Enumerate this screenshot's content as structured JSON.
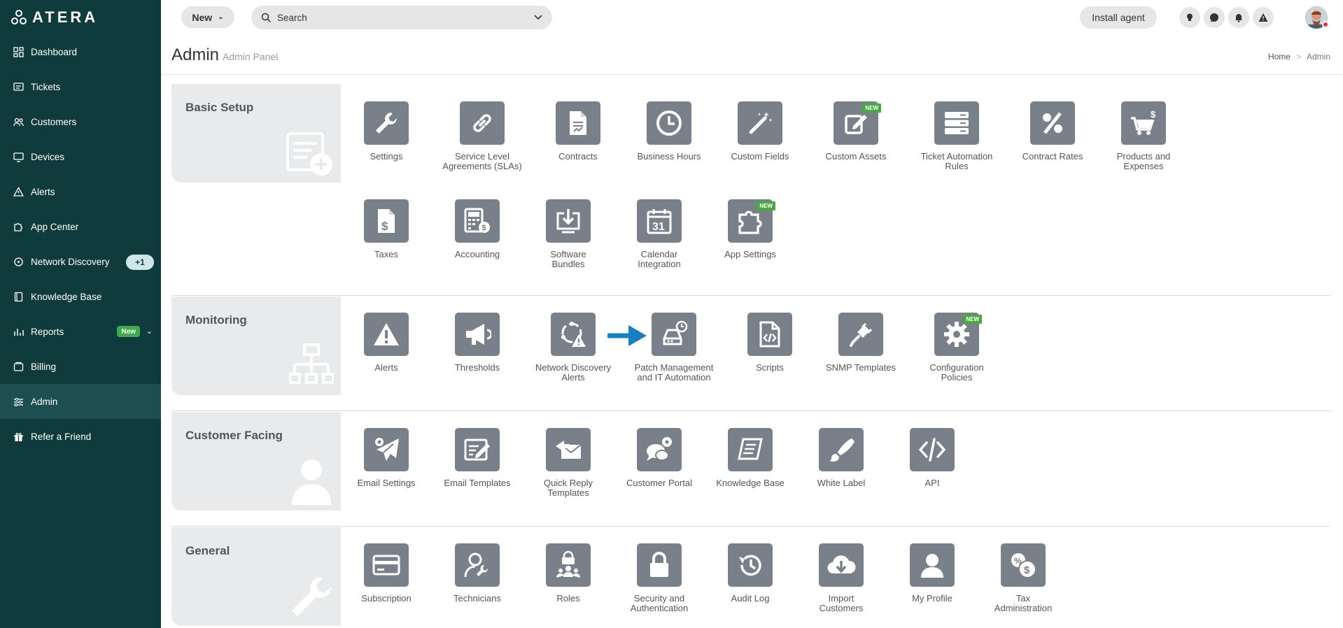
{
  "app": {
    "logo_text": "ATERA"
  },
  "sidebar": {
    "items": [
      {
        "label": "Dashboard",
        "icon": "dashboard-icon"
      },
      {
        "label": "Tickets",
        "icon": "tickets-icon"
      },
      {
        "label": "Customers",
        "icon": "customers-icon"
      },
      {
        "label": "Devices",
        "icon": "devices-icon"
      },
      {
        "label": "Alerts",
        "icon": "alert-triangle-icon"
      },
      {
        "label": "App Center",
        "icon": "puzzle-icon"
      },
      {
        "label": "Network Discovery",
        "icon": "network-icon",
        "badge": "+1"
      },
      {
        "label": "Knowledge Base",
        "icon": "book-icon"
      },
      {
        "label": "Reports",
        "icon": "reports-icon",
        "tag": "New"
      },
      {
        "label": "Billing",
        "icon": "billing-icon"
      },
      {
        "label": "Admin",
        "icon": "admin-sliders-icon",
        "active": true
      },
      {
        "label": "Refer a Friend",
        "icon": "gift-icon"
      }
    ]
  },
  "topbar": {
    "new_label": "New",
    "search_placeholder": "Search",
    "install_label": "Install agent"
  },
  "header": {
    "title": "Admin",
    "subtitle": "Admin Panel",
    "breadcrumb": [
      "Home",
      "Admin"
    ],
    "breadcrumb_sep": ">"
  },
  "sections": {
    "basic": {
      "title": "Basic Setup",
      "tiles": [
        {
          "label": "Settings",
          "icon": "wrench-icon"
        },
        {
          "label": "Service Level\nAgreements (SLAs)",
          "icon": "link-icon"
        },
        {
          "label": "Contracts",
          "icon": "contract-icon"
        },
        {
          "label": "Business Hours",
          "icon": "clock-icon"
        },
        {
          "label": "Custom Fields",
          "icon": "magic-wand-icon"
        },
        {
          "label": "Custom Assets",
          "icon": "edit-note-icon",
          "tag": "NEW"
        },
        {
          "label": "Ticket Automation\nRules",
          "icon": "server-stack-icon"
        },
        {
          "label": "Contract Rates",
          "icon": "percent-icon"
        },
        {
          "label": "Products and\nExpenses",
          "icon": "cart-dollar-icon"
        },
        {
          "label": "Taxes",
          "icon": "tax-doc-icon"
        },
        {
          "label": "Accounting",
          "icon": "calculator-icon"
        },
        {
          "label": "Software\nBundles",
          "icon": "download-box-icon"
        },
        {
          "label": "Calendar\nIntegration",
          "icon": "calendar-icon",
          "day": "31"
        },
        {
          "label": "App Settings",
          "icon": "puzzle-icon",
          "tag": "NEW"
        }
      ]
    },
    "monitoring": {
      "title": "Monitoring",
      "tiles": [
        {
          "label": "Alerts",
          "icon": "warning-icon"
        },
        {
          "label": "Thresholds",
          "icon": "megaphone-icon"
        },
        {
          "label": "Network Discovery\nAlerts",
          "icon": "network-alert-icon"
        },
        {
          "label": "Patch Management\nand IT Automation",
          "icon": "drive-clock-icon"
        },
        {
          "label": "Scripts",
          "icon": "code-file-icon"
        },
        {
          "label": "SNMP Templates",
          "icon": "plug-icon"
        },
        {
          "label": "Configuration\nPolicies",
          "icon": "gear-icon",
          "tag": "NEW"
        }
      ]
    },
    "customer": {
      "title": "Customer Facing",
      "tiles": [
        {
          "label": "Email Settings",
          "icon": "paper-plane-gear-icon"
        },
        {
          "label": "Email Templates",
          "icon": "email-template-icon"
        },
        {
          "label": "Quick Reply\nTemplates",
          "icon": "envelope-reply-icon"
        },
        {
          "label": "Customer Portal",
          "icon": "chat-gear-icon"
        },
        {
          "label": "Knowledge Base",
          "icon": "book-icon"
        },
        {
          "label": "White Label",
          "icon": "brush-icon"
        },
        {
          "label": "API",
          "icon": "code-icon"
        }
      ]
    },
    "general": {
      "title": "General",
      "tiles": [
        {
          "label": "Subscription",
          "icon": "credit-card-icon"
        },
        {
          "label": "Technicians",
          "icon": "technician-icon"
        },
        {
          "label": "Roles",
          "icon": "roles-icon"
        },
        {
          "label": "Security and\nAuthentication",
          "icon": "lock-icon"
        },
        {
          "label": "Audit Log",
          "icon": "history-icon"
        },
        {
          "label": "Import\nCustomers",
          "icon": "cloud-download-icon"
        },
        {
          "label": "My Profile",
          "icon": "user-icon"
        },
        {
          "label": "Tax\nAdministration",
          "icon": "tax-coins-icon"
        }
      ]
    }
  },
  "colors": {
    "sidebar": "#0f3b3c",
    "tile": "#7a8089",
    "accent_arrow": "#1a7fc1",
    "new_tag": "#4aa845"
  }
}
